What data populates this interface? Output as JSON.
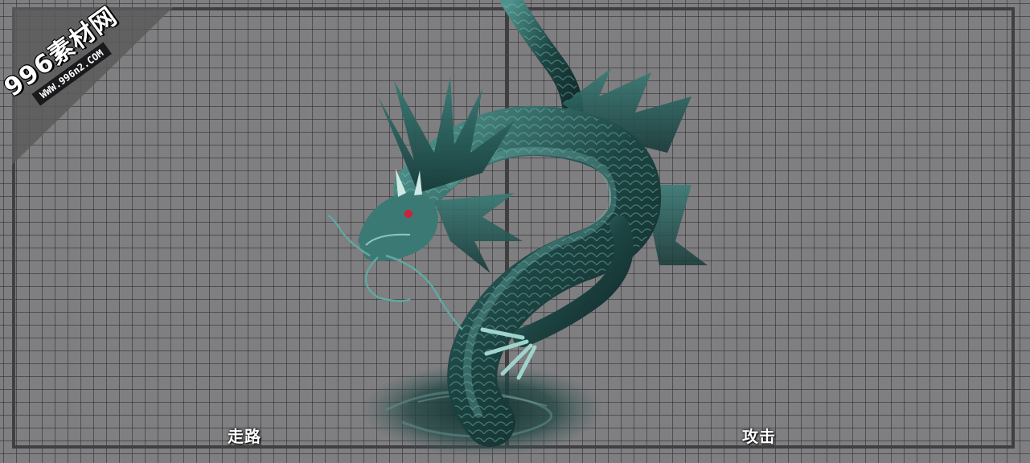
{
  "watermark": {
    "main": "996素材网",
    "site": "WWW.996n2.COM"
  },
  "panels": [
    {
      "label": "走路"
    },
    {
      "label": "攻击"
    }
  ],
  "colors": {
    "background": "#7f7e80",
    "grid_line": "#28282c",
    "frame": "#3f3f42",
    "dragon_body": "#1e4a48",
    "dragon_highlight": "#5fa8a2",
    "eye": "#d0203a"
  }
}
